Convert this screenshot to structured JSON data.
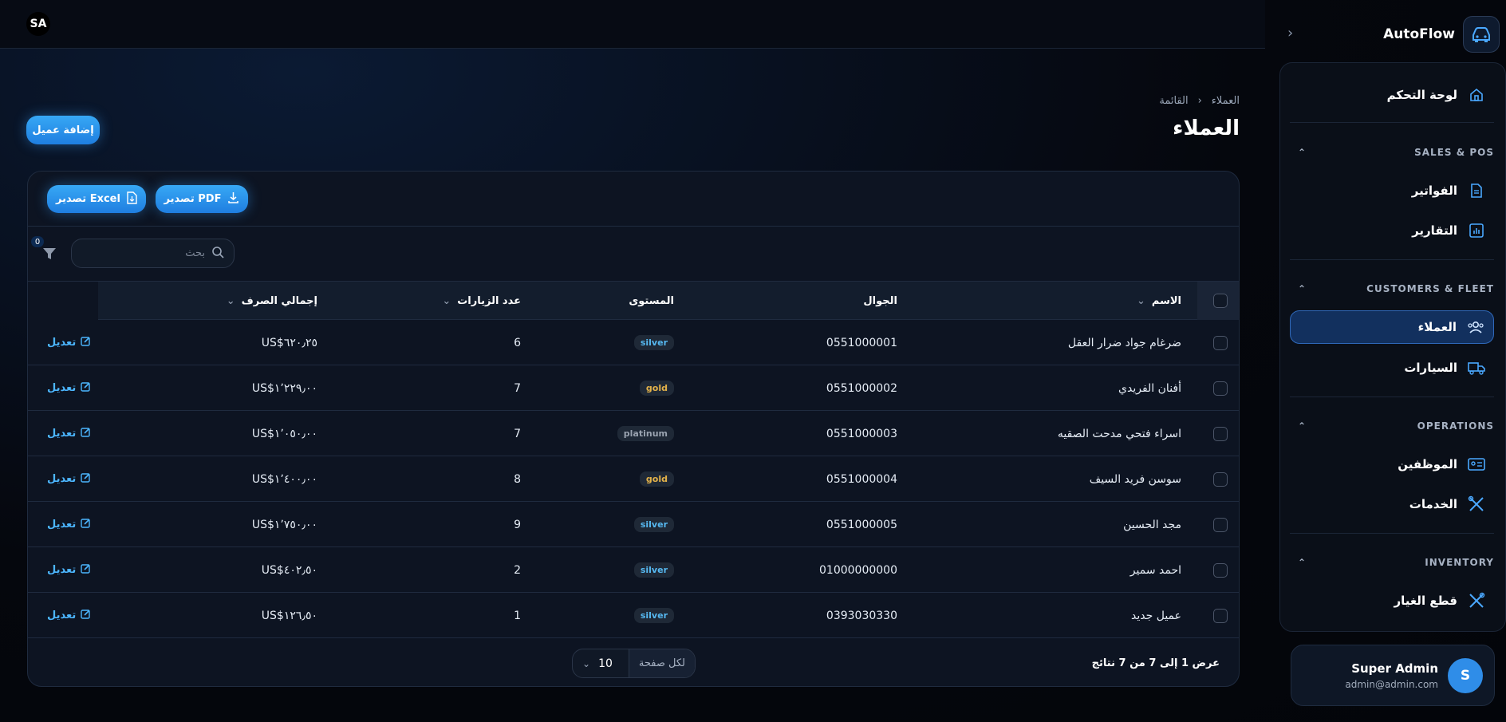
{
  "topbar": {
    "avatar_initials": "SA"
  },
  "sidebar": {
    "brand": "AutoFlow",
    "dashboard": "لوحة التحكم",
    "sections": [
      {
        "title": "SALES & POS",
        "items": [
          "الفواتير",
          "التقارير"
        ]
      },
      {
        "title": "CUSTOMERS & FLEET",
        "items": [
          "العملاء",
          "السيارات"
        ]
      },
      {
        "title": "OPERATIONS",
        "items": [
          "الموظفين",
          "الخدمات"
        ]
      },
      {
        "title": "INVENTORY",
        "items": [
          "قطع الغيار"
        ]
      }
    ],
    "user": {
      "name": "Super Admin",
      "email": "admin@admin.com",
      "initial": "S"
    }
  },
  "header": {
    "breadcrumb": [
      "العملاء",
      "القائمة"
    ],
    "title": "العملاء",
    "add_button": "إضافة عميل"
  },
  "toolbar": {
    "export_pdf": "تصدير PDF",
    "export_excel": "تصدير Excel",
    "search_placeholder": "بحث",
    "filter_count": "0"
  },
  "table": {
    "columns": {
      "name": "الاسم",
      "phone": "الجوال",
      "level": "المستوى",
      "visits": "عدد الزيارات",
      "spend": "إجمالي الصرف"
    },
    "edit_label": "تعديل",
    "rows": [
      {
        "name": "ضرغام جواد ضرار العقل",
        "phone": "0551000001",
        "level": "silver",
        "visits": "6",
        "spend": "US$٦٢٠٫٢٥"
      },
      {
        "name": "أفنان الفريدي",
        "phone": "0551000002",
        "level": "gold",
        "visits": "7",
        "spend": "US$١٬٢٢٩٫٠٠"
      },
      {
        "name": "اسراء فتحي مدحت الصقيه",
        "phone": "0551000003",
        "level": "platinum",
        "visits": "7",
        "spend": "US$١٬٠٥٠٫٠٠"
      },
      {
        "name": "سوسن فريد السيف",
        "phone": "0551000004",
        "level": "gold",
        "visits": "8",
        "spend": "US$١٬٤٠٠٫٠٠"
      },
      {
        "name": "مجد الحسين",
        "phone": "0551000005",
        "level": "silver",
        "visits": "9",
        "spend": "US$١٬٧٥٠٫٠٠"
      },
      {
        "name": "احمد سمير",
        "phone": "01000000000",
        "level": "silver",
        "visits": "2",
        "spend": "US$٤٠٢٫٥٠"
      },
      {
        "name": "عميل جديد",
        "phone": "0393030330",
        "level": "silver",
        "visits": "1",
        "spend": "US$١٢٦٫٥٠"
      }
    ]
  },
  "footer": {
    "summary": "عرض 1 إلى 7 من 7 نتائج",
    "per_page_label": "لكل صفحة",
    "per_page_value": "10"
  },
  "colors": {
    "accent": "#2f8de8",
    "silver": "#56b8f0",
    "gold": "#e3b24a",
    "platinum": "#9aa3b0"
  }
}
